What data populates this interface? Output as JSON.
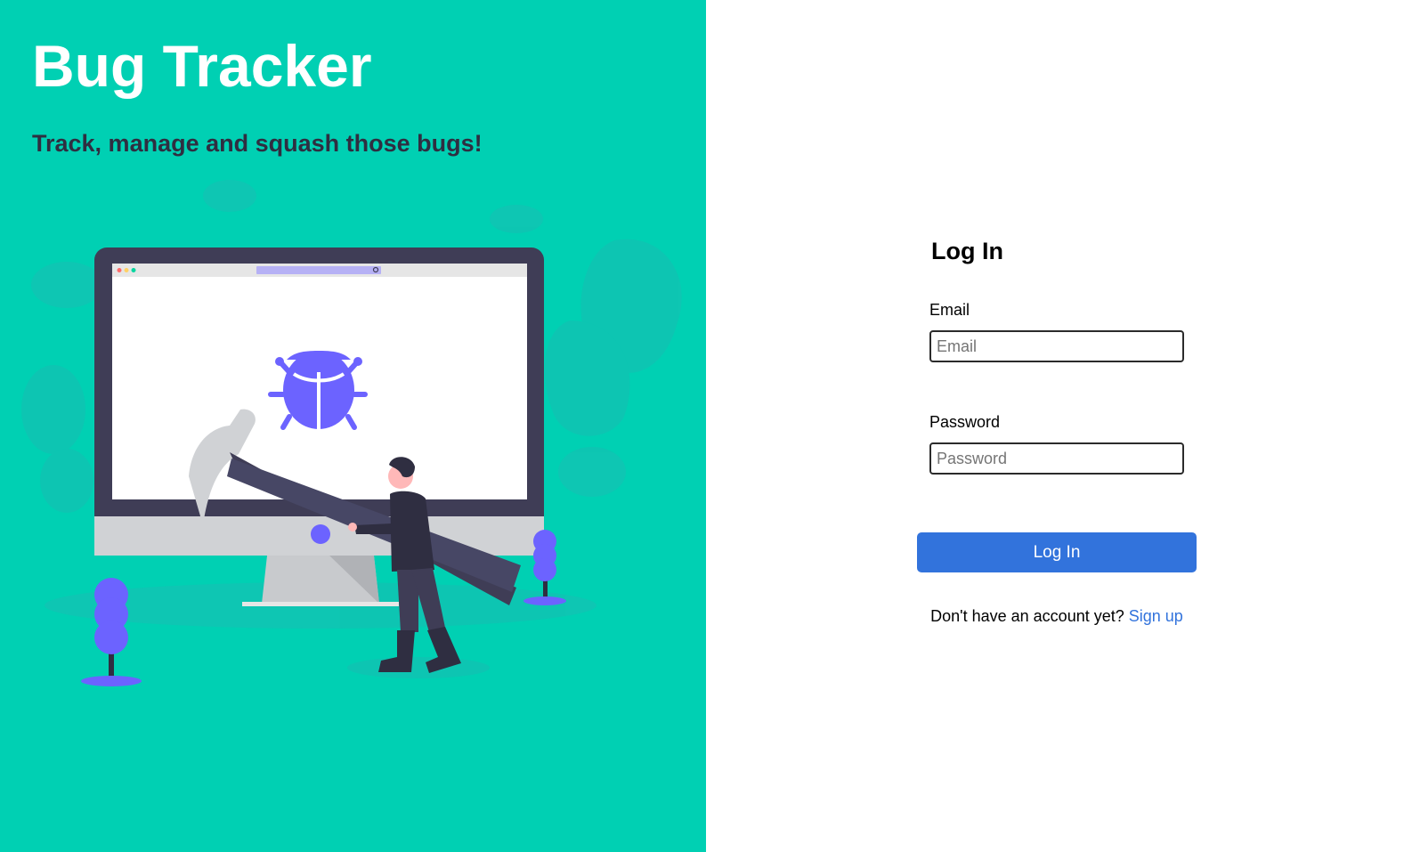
{
  "hero": {
    "title": "Bug Tracker",
    "tagline": "Track, manage and squash those bugs!",
    "illustration": {
      "icon": "bug-icon",
      "description_colors": {
        "background": "#00d0b3",
        "accent": "#6c63ff",
        "monitor_frame": "#3f3d56",
        "monitor_stand": "#d0d2d5"
      }
    }
  },
  "login": {
    "title": "Log In",
    "email": {
      "label": "Email",
      "placeholder": "Email",
      "value": ""
    },
    "password": {
      "label": "Password",
      "placeholder": "Password",
      "value": ""
    },
    "submit_label": "Log In",
    "signup_prompt": "Don't have an account yet?",
    "signup_link": "Sign up"
  },
  "colors": {
    "hero_background": "#00d0b3",
    "primary": "#3273dc",
    "illustration_accent": "#6c63ff",
    "text_dark": "#2f2e41"
  }
}
